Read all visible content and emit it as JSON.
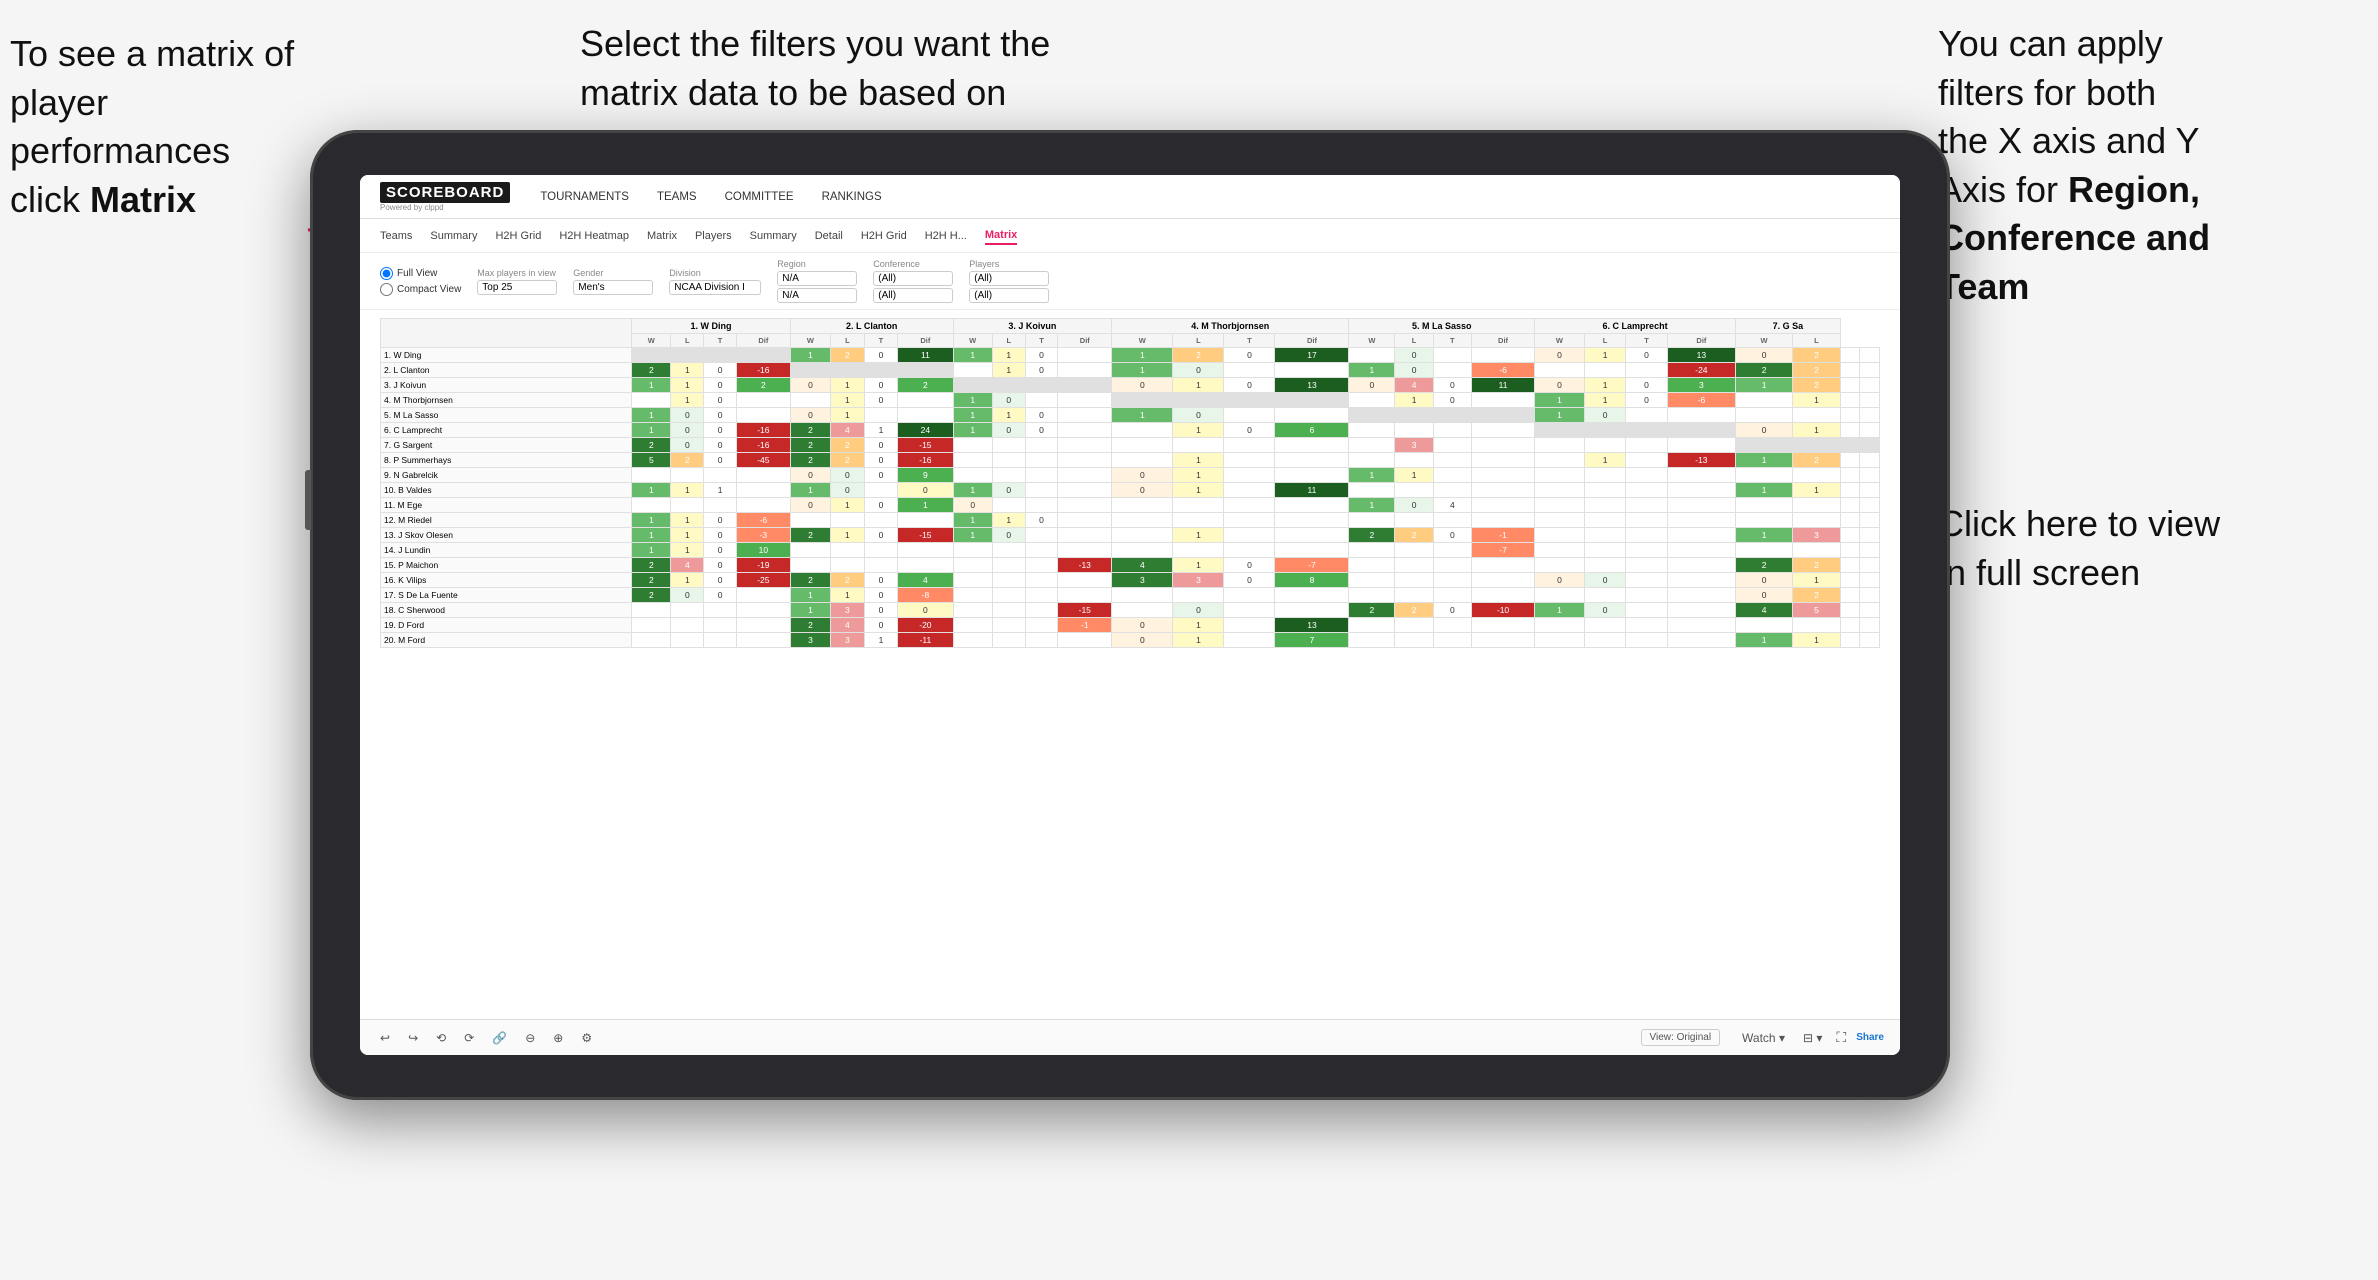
{
  "annotations": {
    "left": {
      "line1": "To see a matrix of",
      "line2": "player performances",
      "line3_pre": "click ",
      "line3_bold": "Matrix"
    },
    "center": {
      "text": "Select the filters you want the matrix data to be based on"
    },
    "right_top": {
      "line1": "You  can apply",
      "line2": "filters for both",
      "line3": "the X axis and Y",
      "line4_pre": "Axis for ",
      "line4_bold": "Region,",
      "line5_bold": "Conference and",
      "line6_bold": "Team"
    },
    "right_bottom": {
      "line1": "Click here to view",
      "line2": "in full screen"
    }
  },
  "nav": {
    "logo": "SCOREBOARD",
    "logo_sub": "Powered by clppd",
    "items": [
      "TOURNAMENTS",
      "TEAMS",
      "COMMITTEE",
      "RANKINGS"
    ]
  },
  "sub_nav": {
    "items": [
      "Teams",
      "Summary",
      "H2H Grid",
      "H2H Heatmap",
      "Matrix",
      "Players",
      "Summary",
      "Detail",
      "H2H Grid",
      "H2H H...",
      "Matrix"
    ]
  },
  "filters": {
    "view_full": "Full View",
    "view_compact": "Compact View",
    "max_players_label": "Max players in view",
    "max_players_value": "Top 25",
    "gender_label": "Gender",
    "gender_value": "Men's",
    "division_label": "Division",
    "division_value": "NCAA Division I",
    "region_label": "Region",
    "region_value_1": "N/A",
    "region_value_2": "N/A",
    "conference_label": "Conference",
    "conference_value_1": "(All)",
    "conference_value_2": "(All)",
    "players_label": "Players",
    "players_value_1": "(All)",
    "players_value_2": "(All)"
  },
  "matrix": {
    "col_headers": [
      "1. W Ding",
      "2. L Clanton",
      "3. J Koivun",
      "4. M Thorbjornsen",
      "5. M La Sasso",
      "6. C Lamprecht",
      "7. G Sa"
    ],
    "sub_headers": [
      "W",
      "L",
      "T",
      "Dif"
    ],
    "rows": [
      {
        "name": "1. W Ding",
        "cells": [
          [
            null,
            null,
            null,
            null
          ],
          [
            1,
            2,
            0,
            11
          ],
          [
            1,
            1,
            0,
            null
          ],
          [
            1,
            2,
            0,
            17
          ],
          [
            null,
            0,
            null,
            null
          ],
          [
            0,
            1,
            0,
            13
          ],
          [
            0,
            2
          ]
        ]
      },
      {
        "name": "2. L Clanton",
        "cells": [
          [
            2,
            1,
            0,
            -16
          ],
          [
            null,
            null,
            null,
            null
          ],
          [
            null,
            1,
            0,
            null
          ],
          [
            1,
            0,
            null,
            null
          ],
          [
            1,
            0,
            null,
            -6
          ],
          [
            null,
            null,
            null,
            -24
          ],
          [
            2,
            2
          ]
        ]
      },
      {
        "name": "3. J Koivun",
        "cells": [
          [
            1,
            1,
            0,
            2
          ],
          [
            0,
            1,
            0,
            2
          ],
          [
            null,
            null,
            null,
            null
          ],
          [
            0,
            1,
            0,
            13
          ],
          [
            0,
            4,
            0,
            11
          ],
          [
            0,
            1,
            0,
            3
          ],
          [
            1,
            2
          ]
        ]
      },
      {
        "name": "4. M Thorbjornsen",
        "cells": [
          [
            null,
            1,
            0,
            null
          ],
          [
            null,
            1,
            0,
            null
          ],
          [
            1,
            0,
            null,
            null
          ],
          [
            null,
            null,
            null,
            null
          ],
          [
            null,
            1,
            0,
            null
          ],
          [
            1,
            1,
            0,
            -6
          ],
          [
            null,
            1
          ]
        ]
      },
      {
        "name": "5. M La Sasso",
        "cells": [
          [
            1,
            0,
            0,
            null
          ],
          [
            0,
            1,
            null,
            null
          ],
          [
            1,
            1,
            0,
            null
          ],
          [
            1,
            0,
            null,
            null
          ],
          [
            null,
            null,
            null,
            null
          ],
          [
            1,
            0,
            null,
            null
          ],
          [
            null,
            null
          ]
        ]
      },
      {
        "name": "6. C Lamprecht",
        "cells": [
          [
            1,
            0,
            0,
            -16
          ],
          [
            2,
            4,
            1,
            24
          ],
          [
            1,
            0,
            0,
            null
          ],
          [
            null,
            1,
            0,
            6
          ],
          [
            null,
            null,
            null,
            null
          ],
          [
            null,
            null,
            null,
            null
          ],
          [
            0,
            1
          ]
        ]
      },
      {
        "name": "7. G Sargent",
        "cells": [
          [
            2,
            0,
            0,
            -16
          ],
          [
            2,
            2,
            0,
            -15
          ],
          [
            null,
            null,
            null,
            null
          ],
          [
            null,
            null,
            null,
            null
          ],
          [
            null,
            3,
            null,
            null
          ],
          [
            null,
            null,
            null,
            null
          ],
          [
            null,
            null
          ]
        ]
      },
      {
        "name": "8. P Summerhays",
        "cells": [
          [
            5,
            2,
            0,
            -45
          ],
          [
            2,
            2,
            0,
            -16
          ],
          [
            null,
            null,
            null,
            null
          ],
          [
            null,
            1,
            null,
            null
          ],
          [
            null,
            null,
            null,
            null
          ],
          [
            null,
            1,
            null,
            -13
          ],
          [
            1,
            2
          ]
        ]
      },
      {
        "name": "9. N Gabrelcik",
        "cells": [
          [
            null,
            null,
            null,
            null
          ],
          [
            0,
            0,
            0,
            9
          ],
          [
            null,
            null,
            null,
            null
          ],
          [
            0,
            1,
            null,
            null
          ],
          [
            1,
            1,
            null,
            null
          ],
          [
            null,
            null,
            null,
            null
          ],
          [
            null,
            null
          ]
        ]
      },
      {
        "name": "10. B Valdes",
        "cells": [
          [
            1,
            1,
            1,
            null
          ],
          [
            1,
            0,
            null,
            0
          ],
          [
            1,
            0,
            null,
            null
          ],
          [
            0,
            1,
            null,
            11
          ],
          [
            null,
            null,
            null,
            null
          ],
          [
            null,
            null,
            null,
            null
          ],
          [
            1,
            1
          ]
        ]
      },
      {
        "name": "11. M Ege",
        "cells": [
          [
            null,
            null,
            null,
            null
          ],
          [
            0,
            1,
            0,
            1
          ],
          [
            0,
            null,
            null,
            null
          ],
          [
            null,
            null,
            null,
            null
          ],
          [
            1,
            0,
            4,
            null
          ],
          [
            null,
            null,
            null,
            null
          ],
          [
            null,
            null
          ]
        ]
      },
      {
        "name": "12. M Riedel",
        "cells": [
          [
            1,
            1,
            0,
            -6
          ],
          [
            null,
            null,
            null,
            null
          ],
          [
            1,
            1,
            0,
            null
          ],
          [
            null,
            null,
            null,
            null
          ],
          [
            null,
            null,
            null,
            null
          ],
          [
            null,
            null,
            null,
            null
          ],
          [
            null,
            null
          ]
        ]
      },
      {
        "name": "13. J Skov Olesen",
        "cells": [
          [
            1,
            1,
            0,
            -3
          ],
          [
            2,
            1,
            0,
            -15
          ],
          [
            1,
            0,
            null,
            null
          ],
          [
            null,
            1,
            null,
            null
          ],
          [
            2,
            2,
            0,
            -1
          ],
          [
            null,
            null,
            null,
            null
          ],
          [
            1,
            3
          ]
        ]
      },
      {
        "name": "14. J Lundin",
        "cells": [
          [
            1,
            1,
            0,
            10
          ],
          [
            null,
            null,
            null,
            null
          ],
          [
            null,
            null,
            null,
            null
          ],
          [
            null,
            null,
            null,
            null
          ],
          [
            null,
            null,
            null,
            -7
          ],
          [
            null,
            null,
            null,
            null
          ],
          [
            null,
            null
          ]
        ]
      },
      {
        "name": "15. P Maichon",
        "cells": [
          [
            2,
            4,
            0,
            -19
          ],
          [
            null,
            null,
            null,
            null
          ],
          [
            null,
            null,
            null,
            -13
          ],
          [
            4,
            1,
            0,
            -7
          ],
          [
            null,
            null,
            null,
            null
          ],
          [
            null,
            null,
            null,
            null
          ],
          [
            2,
            2
          ]
        ]
      },
      {
        "name": "16. K Vilips",
        "cells": [
          [
            2,
            1,
            0,
            -25
          ],
          [
            2,
            2,
            0,
            4
          ],
          [
            null,
            null,
            null,
            null
          ],
          [
            3,
            3,
            0,
            8
          ],
          [
            null,
            null,
            null,
            null
          ],
          [
            0,
            0,
            null,
            null
          ],
          [
            0,
            1
          ]
        ]
      },
      {
        "name": "17. S De La Fuente",
        "cells": [
          [
            2,
            0,
            0,
            null
          ],
          [
            1,
            1,
            0,
            -8
          ],
          [
            null,
            null,
            null,
            null
          ],
          [
            null,
            null,
            null,
            null
          ],
          [
            null,
            null,
            null,
            null
          ],
          [
            null,
            null,
            null,
            null
          ],
          [
            0,
            2
          ]
        ]
      },
      {
        "name": "18. C Sherwood",
        "cells": [
          [
            null,
            null,
            null,
            null
          ],
          [
            1,
            3,
            0,
            0
          ],
          [
            null,
            null,
            null,
            -15
          ],
          [
            null,
            0,
            null,
            null
          ],
          [
            2,
            2,
            0,
            -10
          ],
          [
            1,
            0,
            null,
            null
          ],
          [
            4,
            5
          ]
        ]
      },
      {
        "name": "19. D Ford",
        "cells": [
          [
            null,
            null,
            null,
            null
          ],
          [
            2,
            4,
            0,
            -20
          ],
          [
            null,
            null,
            null,
            -1
          ],
          [
            0,
            1,
            null,
            13
          ],
          [
            null,
            null,
            null,
            null
          ],
          [
            null,
            null,
            null,
            null
          ],
          [
            null,
            null
          ]
        ]
      },
      {
        "name": "20. M Ford",
        "cells": [
          [
            null,
            null,
            null,
            null
          ],
          [
            3,
            3,
            1,
            -11
          ],
          [
            null,
            null,
            null,
            null
          ],
          [
            0,
            1,
            null,
            7
          ],
          [
            null,
            null,
            null,
            null
          ],
          [
            null,
            null,
            null,
            null
          ],
          [
            1,
            1
          ]
        ]
      }
    ]
  },
  "toolbar": {
    "view_label": "View: Original",
    "watch_label": "Watch",
    "share_label": "Share"
  }
}
